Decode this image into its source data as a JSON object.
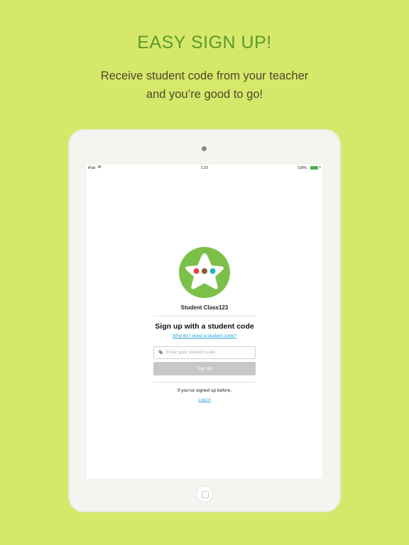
{
  "promo": {
    "headline": "EASY SIGN UP!",
    "subline_1": "Receive student code from your teacher",
    "subline_2": "and you’re good to go!"
  },
  "statusbar": {
    "device": "iPad",
    "time": "1:23",
    "battery": "100%"
  },
  "app": {
    "name": "Student Class123",
    "signup_title": "Sign up with a student code",
    "why_link": "Why do I need a student code?",
    "code_placeholder": "Enter your student code",
    "signup_button": "Sign up",
    "signed_before": "If you’ve signed up before,",
    "login_link": "Log in"
  },
  "colors": {
    "background": "#d6e86a",
    "headline": "#5b9a2a",
    "logo_green": "#7cc04a",
    "link_blue": "#29a3d8",
    "button_disabled": "#c7c7c7"
  },
  "icons": [
    "wifi-icon",
    "battery-icon",
    "tag-icon",
    "star-logo-icon",
    "home-button-icon"
  ]
}
